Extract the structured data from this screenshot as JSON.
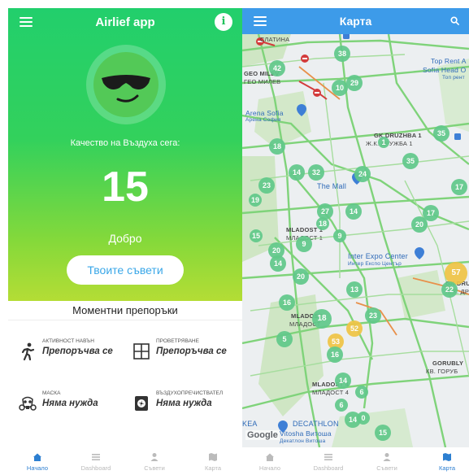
{
  "home": {
    "app_title": "Airlief app",
    "info_icon": "i",
    "quality_label": "Качество на Въздуха сега:",
    "aqi_value": "15",
    "aqi_status": "Добро",
    "tips_button": "Твоите съвети",
    "recommendations_title": "Моментни препоръки",
    "recommendations": [
      {
        "icon": "running-person-icon",
        "label": "АКТИВНОСТ НАВЪН",
        "value": "Препоръчва се"
      },
      {
        "icon": "window-icon",
        "label": "ПРОВЕТРЯВАНЕ",
        "value": "Препоръчва се"
      },
      {
        "icon": "gas-mask-icon",
        "label": "МАСКА",
        "value": "Няма нужда"
      },
      {
        "icon": "air-purifier-icon",
        "label": "ВЪЗДУХОПРЕЧИСТВАТЕЛ",
        "value": "Няма нужда"
      }
    ],
    "colors": {
      "gradient_top": "#22cf6c",
      "gradient_bottom": "#b4dd35",
      "accent": "#3aa7e8"
    }
  },
  "nav": {
    "items": [
      {
        "icon": "home-icon",
        "label": "Начало"
      },
      {
        "icon": "list-icon",
        "label": "Dashboard"
      },
      {
        "icon": "person-icon",
        "label": "Съвети"
      },
      {
        "icon": "map-icon",
        "label": "Карта"
      }
    ],
    "left_active": 0,
    "right_active": 3,
    "active_color": "#2d7fd1"
  },
  "map": {
    "title": "Карта",
    "search_icon": "search-icon",
    "header_color": "#3d9be9",
    "google_logo": "Google",
    "place_labels": [
      "СЛАТИНА",
      "GEO MILEV",
      "ГЕО МИЛЕВ",
      "Arena Sofia",
      "Арена София",
      "Top Rent A",
      "Sofia Head O",
      "Топ рент",
      "GK DRUZHBA 1",
      "Ж.К. ДРУЖБА 1",
      "The Mall",
      "MLADOST 1",
      "МЛАДОСТ 1",
      "Inter Expo Center",
      "Интер Експо Център",
      "GK DRU",
      "Ж.К. ДР",
      "MLADOST",
      "МЛАДОСТ",
      "GORUBLY",
      "КВ. ГОРУБ",
      "MLADOST 4",
      "МЛАДОСТ 4",
      "DECATHLON",
      "Vitosha Витоша",
      "Декатлон Витоша",
      "KEA"
    ],
    "markers": [
      {
        "v": "38",
        "lvl": "good"
      },
      {
        "v": "42",
        "lvl": "good"
      },
      {
        "v": "10",
        "lvl": "good"
      },
      {
        "v": "29",
        "lvl": "good"
      },
      {
        "v": "35",
        "lvl": "good"
      },
      {
        "v": "1",
        "lvl": "good"
      },
      {
        "v": "35",
        "lvl": "good"
      },
      {
        "v": "18",
        "lvl": "good"
      },
      {
        "v": "14",
        "lvl": "good"
      },
      {
        "v": "32",
        "lvl": "good"
      },
      {
        "v": "24",
        "lvl": "good"
      },
      {
        "v": "17",
        "lvl": "good"
      },
      {
        "v": "23",
        "lvl": "good"
      },
      {
        "v": "19",
        "lvl": "good"
      },
      {
        "v": "27",
        "lvl": "good"
      },
      {
        "v": "14",
        "lvl": "good"
      },
      {
        "v": "18",
        "lvl": "good"
      },
      {
        "v": "9",
        "lvl": "good"
      },
      {
        "v": "20",
        "lvl": "good"
      },
      {
        "v": "15",
        "lvl": "good"
      },
      {
        "v": "17",
        "lvl": "good"
      },
      {
        "v": "20",
        "lvl": "good"
      },
      {
        "v": "14",
        "lvl": "good"
      },
      {
        "v": "9",
        "lvl": "good"
      },
      {
        "v": "20",
        "lvl": "good"
      },
      {
        "v": "57",
        "lvl": "moderate"
      },
      {
        "v": "22",
        "lvl": "good"
      },
      {
        "v": "13",
        "lvl": "good"
      },
      {
        "v": "16",
        "lvl": "good"
      },
      {
        "v": "18",
        "lvl": "good"
      },
      {
        "v": "23",
        "lvl": "good"
      },
      {
        "v": "52",
        "lvl": "moderate"
      },
      {
        "v": "53",
        "lvl": "moderate"
      },
      {
        "v": "5",
        "lvl": "good"
      },
      {
        "v": "16",
        "lvl": "good"
      },
      {
        "v": "14",
        "lvl": "good"
      },
      {
        "v": "6",
        "lvl": "good"
      },
      {
        "v": "6",
        "lvl": "good"
      },
      {
        "v": "14",
        "lvl": "good"
      },
      {
        "v": "0",
        "lvl": "good"
      },
      {
        "v": "15",
        "lvl": "good"
      }
    ],
    "marker_colors": {
      "good": "#61c98a",
      "moderate": "#f0c445"
    }
  }
}
